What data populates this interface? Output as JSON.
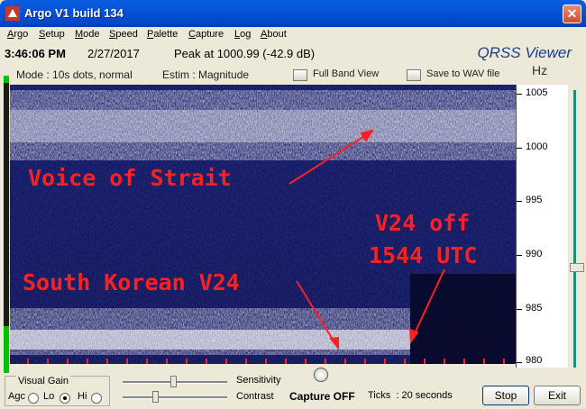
{
  "window": {
    "title": "Argo V1 build 134",
    "close_glyph": "✕"
  },
  "menu": [
    "Argo",
    "Setup",
    "Mode",
    "Speed",
    "Palette",
    "Capture",
    "Log",
    "About"
  ],
  "status": {
    "time": "3:46:06 PM",
    "date": "2/27/2017",
    "peak": "Peak at 1000.99 (-42.9 dB)",
    "brand": "QRSS Viewer"
  },
  "mode_row": {
    "mode": "Mode : 10s dots, normal",
    "estim": "Estim : Magnitude",
    "full_band": "Full Band View",
    "save_wav": "Save to WAV file",
    "unit": "Hz"
  },
  "freq_scale": [
    "1005",
    "1000",
    "995",
    "990",
    "985",
    "980"
  ],
  "annotations": {
    "voice": "Voice of Strait",
    "v24_off_1": "V24 off",
    "v24_off_2": "1544 UTC",
    "south": "South Korean V24"
  },
  "bottom": {
    "visual_gain": "Visual Gain",
    "agc": "Agc",
    "lo": "Lo",
    "hi": "Hi",
    "sensitivity": "Sensitivity",
    "contrast": "Contrast",
    "capture": "Capture OFF",
    "ticks": "Ticks  : 20 seconds",
    "stop": "Stop",
    "exit": "Exit"
  },
  "gain_selected": "Lo",
  "colors": {
    "spectrum_bg": "#0a0a46",
    "annotation": "#ff2020",
    "brand": "#1a3f8a"
  }
}
